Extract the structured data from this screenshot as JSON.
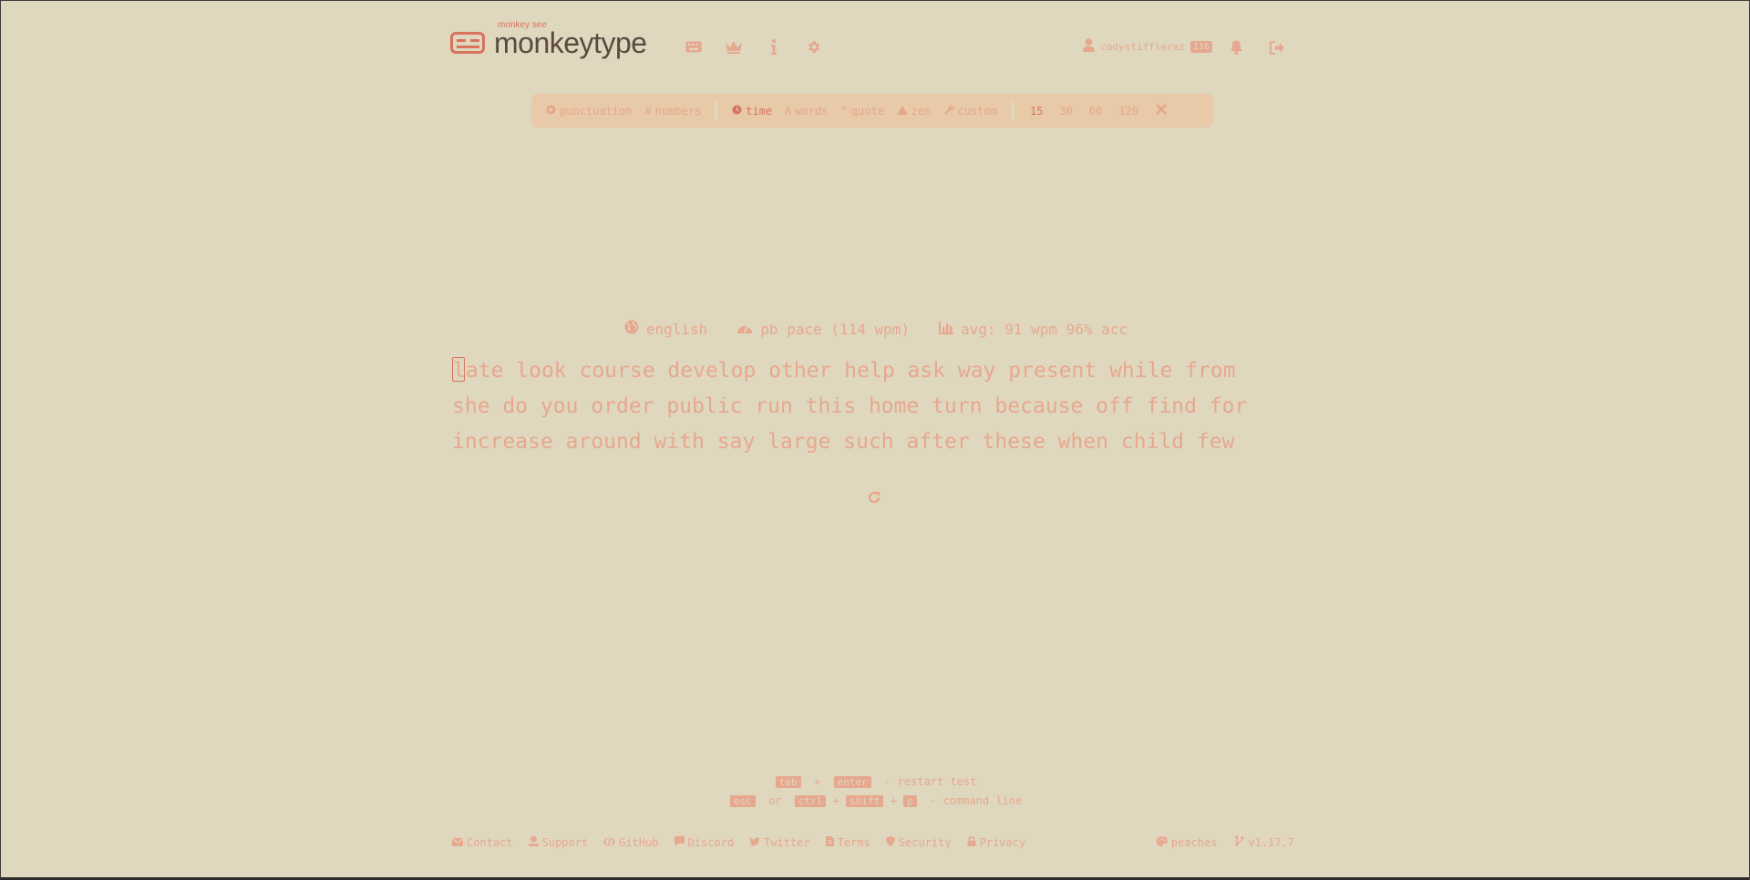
{
  "header": {
    "logo_subtitle": "monkey see",
    "logo_text": "monkeytype",
    "username": "codystiffleraz",
    "level": "116"
  },
  "mode_bar": {
    "punctuation": "punctuation",
    "numbers": "numbers",
    "modes": [
      {
        "label": "time",
        "active": true
      },
      {
        "label": "words",
        "active": false
      },
      {
        "label": "quote",
        "active": false
      },
      {
        "label": "zen",
        "active": false
      },
      {
        "label": "custom",
        "active": false
      }
    ],
    "times": [
      {
        "label": "15",
        "active": true
      },
      {
        "label": "30",
        "active": false
      },
      {
        "label": "60",
        "active": false
      },
      {
        "label": "120",
        "active": false
      }
    ]
  },
  "test_info": {
    "language": "english",
    "pace": "pb pace (114 wpm)",
    "average": "avg: 91 wpm 96% acc"
  },
  "words": {
    "first_char": "l",
    "line1_rest": "ate look course develop other help ask way present while from",
    "line2": "she do you order public run this home turn because off find for",
    "line3": "increase around with say large such after these when child few"
  },
  "shortcuts": {
    "key_tab": "tab",
    "plus": "+",
    "key_enter": "enter",
    "restart_text": "- restart test",
    "key_esc": "esc",
    "or": "or",
    "key_ctrl": "ctrl",
    "key_shift": "shift",
    "key_p": "p",
    "command_text": "- command line"
  },
  "footer": {
    "links": [
      "Contact",
      "Support",
      "GitHub",
      "Discord",
      "Twitter",
      "Terms",
      "Security",
      "Privacy"
    ],
    "theme": "peaches",
    "version": "v1.17.7"
  }
}
